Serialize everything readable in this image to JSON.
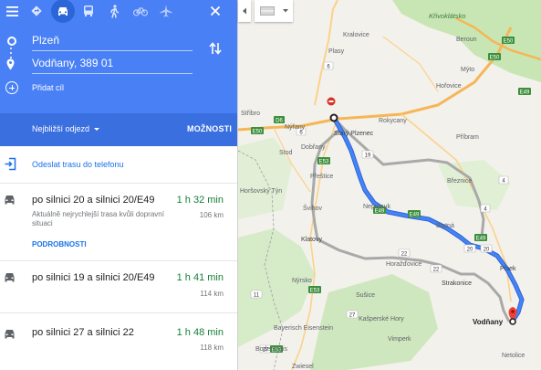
{
  "top": {
    "menu_icon": "hamburger-icon",
    "modes": [
      {
        "icon": "directions-icon",
        "active": false
      },
      {
        "icon": "car-icon",
        "active": true
      },
      {
        "icon": "transit-icon",
        "active": false
      },
      {
        "icon": "walk-icon",
        "active": false
      },
      {
        "icon": "bicycle-icon",
        "active": false
      },
      {
        "icon": "flight-icon",
        "active": false
      }
    ],
    "close_icon": "close-icon"
  },
  "inputs": {
    "origin": "Plzeň",
    "destination": "Vodňany, 389 01",
    "add_stop": "Přidat cíl"
  },
  "depart": {
    "label": "Nejbližší odjezd",
    "options_label": "MOŽNOSTI"
  },
  "send_to_phone": "Odeslat trasu do telefonu",
  "routes": [
    {
      "name": "po silnici 20 a silnici 20/E49",
      "time": "1 h 32 min",
      "distance": "106 km",
      "note": "Aktuálně nejrychlejší trasa kvůli dopravní situaci",
      "details": "PODROBNOSTI"
    },
    {
      "name": "po silnici 19 a silnici 20/E49",
      "time": "1 h 41 min",
      "distance": "114 km"
    },
    {
      "name": "po silnici 27 a silnici 22",
      "time": "1 h 48 min",
      "distance": "118 km"
    }
  ],
  "map": {
    "places": [
      {
        "name": "Křivoklátsko",
        "style": "park"
      },
      {
        "name": "Beroun",
        "style": "town"
      },
      {
        "name": "Kralovice",
        "style": "town"
      },
      {
        "name": "Plasy",
        "style": "town"
      },
      {
        "name": "Mýto",
        "style": "town"
      },
      {
        "name": "Hořovice",
        "style": "town"
      },
      {
        "name": "Stříbro",
        "style": "town"
      },
      {
        "name": "Nýřany",
        "style": "town"
      },
      {
        "name": "Rokycany",
        "style": "town"
      },
      {
        "name": "Starý Plzenec",
        "style": "town"
      },
      {
        "name": "Příbram",
        "style": "town"
      },
      {
        "name": "Stod",
        "style": "town"
      },
      {
        "name": "Dobřany",
        "style": "town"
      },
      {
        "name": "Přeštice",
        "style": "town"
      },
      {
        "name": "Horšovský Týn",
        "style": "town"
      },
      {
        "name": "Březnice",
        "style": "town"
      },
      {
        "name": "Švihov",
        "style": "town"
      },
      {
        "name": "Nepomuk",
        "style": "town"
      },
      {
        "name": "Blatná",
        "style": "town"
      },
      {
        "name": "Klatovy",
        "style": "town"
      },
      {
        "name": "Horažďovice",
        "style": "town"
      },
      {
        "name": "Písek",
        "style": "town"
      },
      {
        "name": "Sušice",
        "style": "town"
      },
      {
        "name": "Strakonice",
        "style": "town"
      },
      {
        "name": "Nýrsko",
        "style": "town"
      },
      {
        "name": "Kašperské Hory",
        "style": "town"
      },
      {
        "name": "Vodňany",
        "style": "destination"
      },
      {
        "name": "Bayerisch Eisenstein",
        "style": "town"
      },
      {
        "name": "Vimperk",
        "style": "town"
      },
      {
        "name": "Netolice",
        "style": "town"
      },
      {
        "name": "Bodenmais",
        "style": "town"
      },
      {
        "name": "Zwiesel",
        "style": "town"
      }
    ],
    "shields": [
      "6",
      "E50",
      "D6",
      "6",
      "E50",
      "19",
      "E53",
      "E49",
      "E49",
      "4",
      "20",
      "22",
      "20",
      "E53",
      "27",
      "27",
      "E49",
      "4",
      "22",
      "11",
      "E49",
      "E50",
      "E53"
    ],
    "colors": {
      "route_primary": "#4285f4",
      "route_alt": "#a9a9a9",
      "motorway": "#f6b655",
      "green": "#c8e6b4"
    }
  }
}
